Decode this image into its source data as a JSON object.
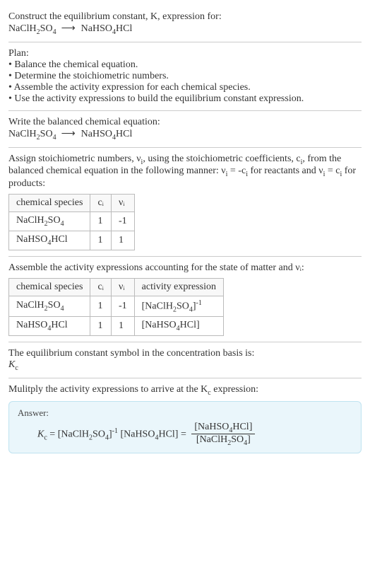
{
  "intro": {
    "line1": "Construct the equilibrium constant, K, expression for:",
    "eq_lhs": "NaClH",
    "eq_lhs_sub1": "2",
    "eq_lhs_tail": "SO",
    "eq_lhs_sub2": "4",
    "arrow": "⟶",
    "eq_rhs": "NaHSO",
    "eq_rhs_sub": "4",
    "eq_rhs_tail": "HCl"
  },
  "plan": {
    "title": "Plan:",
    "b1": "• Balance the chemical equation.",
    "b2": "• Determine the stoichiometric numbers.",
    "b3": "• Assemble the activity expression for each chemical species.",
    "b4": "• Use the activity expressions to build the equilibrium constant expression."
  },
  "balanced": {
    "title": "Write the balanced chemical equation:"
  },
  "stoich": {
    "text_a": "Assign stoichiometric numbers, ν",
    "text_b": ", using the stoichiometric coefficients, c",
    "text_c": ", from the balanced chemical equation in the following manner: ν",
    "text_d": " = -c",
    "text_e": " for reactants and ν",
    "text_f": " = c",
    "text_g": " for products:",
    "head": {
      "h1": "chemical species",
      "h2": "cᵢ",
      "h3": "νᵢ"
    },
    "rows": [
      {
        "species_a": "NaClH",
        "sub1": "2",
        "species_b": "SO",
        "sub2": "4",
        "tail": "",
        "c": "1",
        "nu": "-1"
      },
      {
        "species_a": "NaHSO",
        "sub1": "4",
        "species_b": "HCl",
        "sub2": "",
        "tail": "",
        "c": "1",
        "nu": "1"
      }
    ]
  },
  "activity": {
    "title": "Assemble the activity expressions accounting for the state of matter and νᵢ:",
    "head": {
      "h1": "chemical species",
      "h2": "cᵢ",
      "h3": "νᵢ",
      "h4": "activity expression"
    },
    "rows": [
      {
        "species_a": "NaClH",
        "sub1": "2",
        "species_b": "SO",
        "sub2": "4",
        "c": "1",
        "nu": "-1",
        "expr_a": "[NaClH",
        "expr_s1": "2",
        "expr_b": "SO",
        "expr_s2": "4",
        "expr_c": "]",
        "expr_pow": "-1"
      },
      {
        "species_a": "NaHSO",
        "sub1": "4",
        "species_b": "HCl",
        "sub2": "",
        "c": "1",
        "nu": "1",
        "expr_a": "[NaHSO",
        "expr_s1": "4",
        "expr_b": "HCl]",
        "expr_s2": "",
        "expr_c": "",
        "expr_pow": ""
      }
    ]
  },
  "symbol": {
    "line1": "The equilibrium constant symbol in the concentration basis is:",
    "kc_k": "K",
    "kc_c": "c"
  },
  "final": {
    "title": "Mulitply the activity expressions to arrive at the K",
    "title_sub": "c",
    "title_tail": " expression:",
    "answer_label": "Answer:",
    "lhs_k": "K",
    "lhs_c": "c",
    "eq": " = ",
    "term1_a": "[NaClH",
    "term1_s1": "2",
    "term1_b": "SO",
    "term1_s2": "4",
    "term1_c": "]",
    "term1_pow": "-1",
    "term2_a": " [NaHSO",
    "term2_s1": "4",
    "term2_b": "HCl] = ",
    "frac_num_a": "[NaHSO",
    "frac_num_s": "4",
    "frac_num_b": "HCl]",
    "frac_den_a": "[NaClH",
    "frac_den_s1": "2",
    "frac_den_b": "SO",
    "frac_den_s2": "4",
    "frac_den_c": "]"
  },
  "chart_data": {
    "type": "table",
    "tables": [
      {
        "title": "stoichiometric numbers",
        "columns": [
          "chemical species",
          "cᵢ",
          "νᵢ"
        ],
        "rows": [
          [
            "NaClH2SO4",
            1,
            -1
          ],
          [
            "NaHSO4HCl",
            1,
            1
          ]
        ]
      },
      {
        "title": "activity expressions",
        "columns": [
          "chemical species",
          "cᵢ",
          "νᵢ",
          "activity expression"
        ],
        "rows": [
          [
            "NaClH2SO4",
            1,
            -1,
            "[NaClH2SO4]^-1"
          ],
          [
            "NaHSO4HCl",
            1,
            1,
            "[NaHSO4HCl]"
          ]
        ]
      }
    ]
  }
}
